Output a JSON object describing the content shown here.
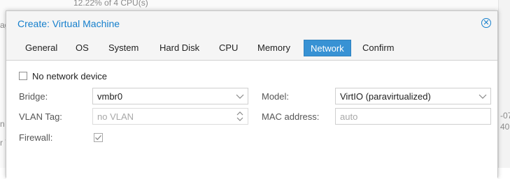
{
  "background": {
    "top_text": "12.22% of 4 CPU(s)",
    "left_frag_1": "age",
    "left_frag_2": "n",
    "left_frag_3": "r V",
    "right_frag_1": "-07",
    "right_frag_2": "40:"
  },
  "window": {
    "title": "Create: Virtual Machine",
    "close_icon": "close-circle-icon"
  },
  "tabs": [
    {
      "label": "General",
      "active": false
    },
    {
      "label": "OS",
      "active": false
    },
    {
      "label": "System",
      "active": false
    },
    {
      "label": "Hard Disk",
      "active": false
    },
    {
      "label": "CPU",
      "active": false
    },
    {
      "label": "Memory",
      "active": false
    },
    {
      "label": "Network",
      "active": true
    },
    {
      "label": "Confirm",
      "active": false
    }
  ],
  "form": {
    "no_network_device": {
      "label": "No network device",
      "checked": false
    },
    "bridge": {
      "label": "Bridge:",
      "value": "vmbr0"
    },
    "vlan_tag": {
      "label": "VLAN Tag:",
      "placeholder": "no VLAN"
    },
    "firewall": {
      "label": "Firewall:",
      "checked": true
    },
    "model": {
      "label": "Model:",
      "value": "VirtIO (paravirtualized)"
    },
    "mac_address": {
      "label": "MAC address:",
      "placeholder": "auto"
    }
  },
  "colors": {
    "accent": "#157fcc",
    "active_tab": "#3892d4"
  }
}
